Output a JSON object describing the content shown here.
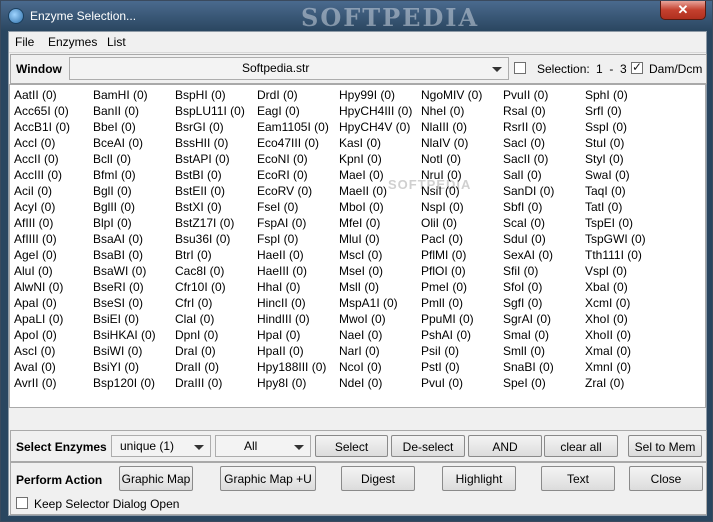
{
  "window": {
    "title": "Enzyme Selection...",
    "watermark": "SOFTPEDIA",
    "close_glyph": "✕"
  },
  "menu": [
    "File",
    "Enzymes",
    "List"
  ],
  "window_bar": {
    "label": "Window",
    "combo_value": "Softpedia.str",
    "selection_label": "Selection:",
    "selection_range": "1  -  3",
    "dam_dcm_label": "Dam/Dcm",
    "dam_dcm_checked": true,
    "selection_checked": false
  },
  "grid_watermark": "SOFTPEDIA",
  "enzyme_columns": [
    [
      "AatII (0)",
      "Acc65I (0)",
      "AccB1I (0)",
      "AccI (0)",
      "AccII (0)",
      "AccIII (0)",
      "AciI (0)",
      "AcyI (0)",
      "AfIII (0)",
      "AfIIII (0)",
      "AgeI (0)",
      "AluI (0)",
      "AlwNI (0)",
      "ApaI (0)",
      "ApaLI (0)",
      "ApoI (0)",
      "AscI (0)",
      "AvaI (0)",
      "AvrII (0)"
    ],
    [
      "BamHI (0)",
      "BanII (0)",
      "BbeI (0)",
      "BceAI (0)",
      "BclI (0)",
      "BfmI (0)",
      "BglI (0)",
      "BglII (0)",
      "BlpI (0)",
      "BsaAI (0)",
      "BsaBI (0)",
      "BsaWI (0)",
      "BseRI (0)",
      "BseSI (0)",
      "BsiEI (0)",
      "BsiHKAI (0)",
      "BsiWI (0)",
      "BsiYI (0)",
      "Bsp120I (0)"
    ],
    [
      "BspHI (0)",
      "BspLU11I (0)",
      "BsrGI (0)",
      "BssHII (0)",
      "BstAPI (0)",
      "BstBI (0)",
      "BstEII (0)",
      "BstXI (0)",
      "BstZ17I (0)",
      "Bsu36I (0)",
      "BtrI (0)",
      "Cac8I (0)",
      "Cfr10I (0)",
      "CfrI (0)",
      "ClaI (0)",
      "DpnI (0)",
      "DraI (0)",
      "DraII (0)",
      "DraIII (0)"
    ],
    [
      "DrdI (0)",
      "EagI (0)",
      "Eam1105I (0)",
      "Eco47III (0)",
      "EcoNI (0)",
      "EcoRI (0)",
      "EcoRV (0)",
      "FseI (0)",
      "FspAI (0)",
      "FspI (0)",
      "HaeII (0)",
      "HaeIII (0)",
      "HhaI (0)",
      "HincII (0)",
      "HindIII (0)",
      "HpaI (0)",
      "HpaII (0)",
      "Hpy188III (0)",
      "Hpy8I (0)"
    ],
    [
      "Hpy99I (0)",
      "HpyCH4III (0)",
      "HpyCH4V (0)",
      "KasI (0)",
      "KpnI (0)",
      "MaeI (0)",
      "MaeII (0)",
      "MboI (0)",
      "MfeI (0)",
      "MluI (0)",
      "MscI (0)",
      "MseI (0)",
      "MslI (0)",
      "MspA1I (0)",
      "MwoI (0)",
      "NaeI (0)",
      "NarI (0)",
      "NcoI (0)",
      "NdeI (0)"
    ],
    [
      "NgoMIV (0)",
      "NheI (0)",
      "NlaIII (0)",
      "NlaIV (0)",
      "NotI (0)",
      "NruI (0)",
      "NsiI (0)",
      "NspI (0)",
      "OliI (0)",
      "PacI (0)",
      "PflMI (0)",
      "PflOI (0)",
      "PmeI (0)",
      "PmlI (0)",
      "PpuMI (0)",
      "PshAI (0)",
      "PsiI (0)",
      "PstI (0)",
      "PvuI (0)"
    ],
    [
      "PvuII (0)",
      "RsaI (0)",
      "RsrII (0)",
      "SacI (0)",
      "SacII (0)",
      "SalI (0)",
      "SanDI (0)",
      "SbfI (0)",
      "ScaI (0)",
      "SduI (0)",
      "SexAI (0)",
      "SfiI (0)",
      "SfoI (0)",
      "SgfI (0)",
      "SgrAI (0)",
      "SmaI (0)",
      "SmlI (0)",
      "SnaBI (0)",
      "SpeI (0)"
    ],
    [
      "SphI (0)",
      "SrfI (0)",
      "SspI (0)",
      "StuI (0)",
      "StyI (0)",
      "SwaI (0)",
      "TaqI (0)",
      "TatI (0)",
      "TspEI (0)",
      "TspGWI (0)",
      "Tth111I (0)",
      "VspI (0)",
      "XbaI (0)",
      "XcmI (0)",
      "XhoI (0)",
      "XhoII (0)",
      "XmaI (0)",
      "XmnI (0)",
      "ZraI (0)"
    ]
  ],
  "select_row": {
    "label": "Select Enzymes",
    "mode_value": "unique (1)",
    "scope_value": "All",
    "select": "Select",
    "deselect": "De-select",
    "and": "AND",
    "clear_all": "clear all",
    "sel_to_mem": "Sel to Mem"
  },
  "action_row": {
    "label": "Perform Action",
    "graphic_map": "Graphic Map",
    "graphic_map_u": "Graphic Map +U",
    "digest": "Digest",
    "highlight": "Highlight",
    "text": "Text",
    "close": "Close"
  },
  "keep_open": {
    "label": "Keep Selector Dialog Open",
    "checked": false
  }
}
